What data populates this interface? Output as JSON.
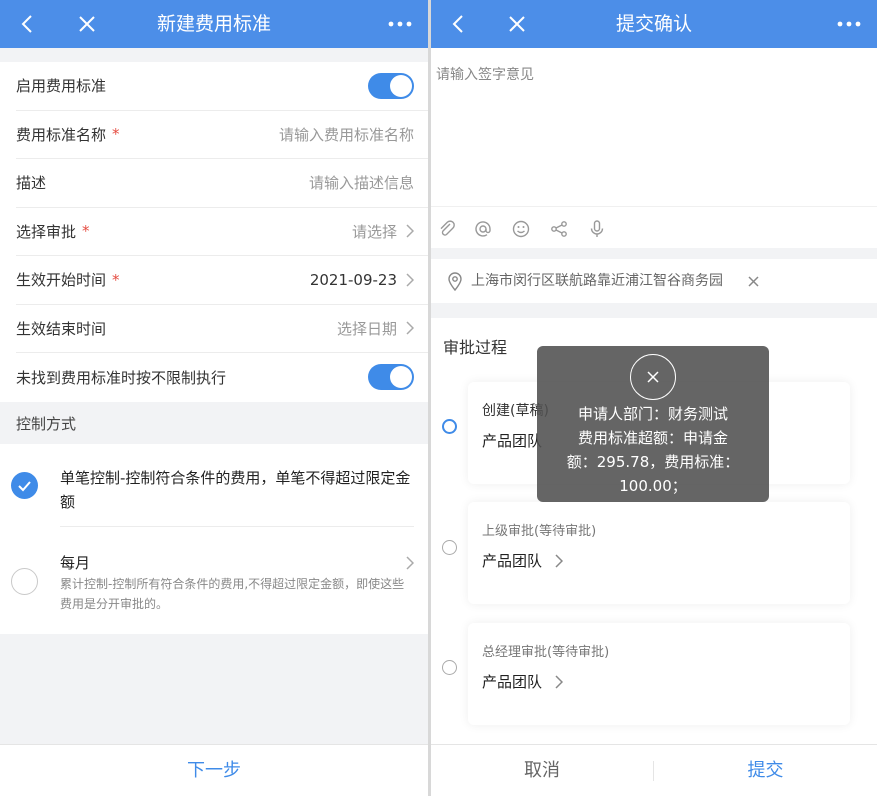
{
  "left": {
    "nav": {
      "title": "新建费用标准"
    },
    "form": {
      "enable_label": "启用费用标准",
      "name_label": "费用标准名称",
      "name_required": "*",
      "name_placeholder": "请输入费用标准名称",
      "desc_label": "描述",
      "desc_placeholder": "请输入描述信息",
      "approval_label": "选择审批",
      "approval_required": "*",
      "approval_value": "请选择",
      "start_label": "生效开始时间",
      "start_required": "*",
      "start_value": "2021-09-23",
      "end_label": "生效结束时间",
      "end_value": "选择日期",
      "unlimited_label": "未找到费用标准时按不限制执行"
    },
    "control": {
      "section_label": "控制方式",
      "option1_text": "单笔控制-控制符合条件的费用，单笔不得超过限定金额",
      "option2_title": "每月",
      "option2_desc": "累计控制-控制所有符合条件的费用,不得超过限定金额，即使这些费用是分开审批的。"
    },
    "bottom": {
      "next_label": "下一步"
    }
  },
  "right": {
    "nav": {
      "title": "提交确认"
    },
    "comment_placeholder": "请输入签字意见",
    "location": "上海市闵行区联航路靠近浦江智谷商务园",
    "approval": {
      "title": "审批过程",
      "steps": [
        {
          "status": "创建(草稿)",
          "team": "产品团队"
        },
        {
          "status": "上级审批(等待审批)",
          "team": "产品团队"
        },
        {
          "status": "总经理审批(等待审批)",
          "team": "产品团队"
        }
      ]
    },
    "toast": {
      "line1": "申请人部门：财务测试",
      "line2": "费用标准超额：申请金",
      "line3": "额：295.78，费用标准：",
      "line4": "100.00；"
    },
    "bottom": {
      "cancel_label": "取消",
      "submit_label": "提交"
    }
  },
  "colors": {
    "nav_bg": "#4c8ee8",
    "accent": "#3f8be8",
    "required": "#e54d42"
  }
}
